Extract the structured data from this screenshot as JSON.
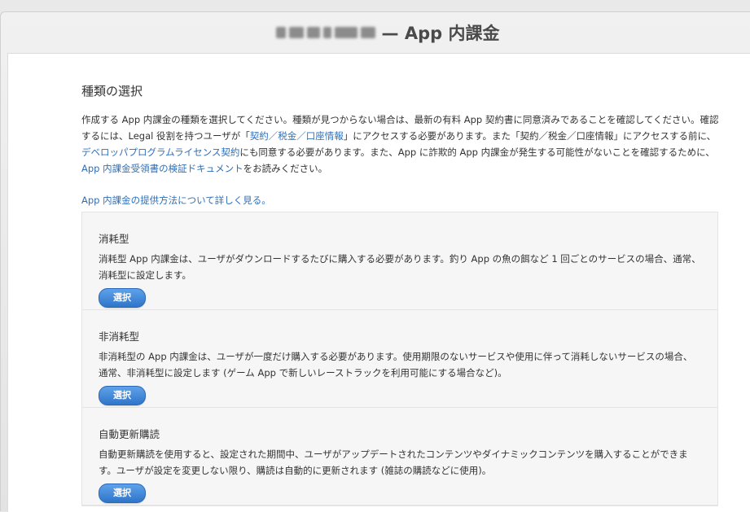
{
  "window": {
    "title_suffix": "— App 内課金"
  },
  "header": {
    "section_title": "種類の選択"
  },
  "description": {
    "part1": "作成する App 内課金の種類を選択してください。種類が見つからない場合は、最新の有料 App 契約書に同意済みであることを確認してください。確認するには、Legal 役割を持つユーザが「",
    "link1": "契約／税金／口座情報",
    "part2": "」にアクセスする必要があります。また「契約／税金／口座情報」にアクセスする前に、",
    "link2": "デベロッパプログラムライセンス契約",
    "part3": "にも同意する必要があります。また、App に詐欺的 App 内課金が発生する可能性がないことを確認するために、",
    "link3": "App 内課金受領書の検証ドキュメント",
    "part4": "をお読みください。"
  },
  "learn_more": "App 内課金の提供方法について詳しく見る。",
  "types": [
    {
      "name": "消耗型",
      "description": "消耗型 App 内課金は、ユーザがダウンロードするたびに購入する必要があります。釣り App の魚の餌など 1 回ごとのサービスの場合、通常、消耗型に設定します。",
      "button_label": "選択"
    },
    {
      "name": "非消耗型",
      "description": "非消耗型の App 内課金は、ユーザが一度だけ購入する必要があります。使用期限のないサービスや使用に伴って消耗しないサービスの場合、通常、非消耗型に設定します (ゲーム App で新しいレーストラックを利用可能にする場合など)。",
      "button_label": "選択"
    },
    {
      "name": "自動更新購読",
      "description": "自動更新購読を使用すると、設定された期間中、ユーザがアップデートされたコンテンツやダイナミックコンテンツを購入することができます。ユーザが設定を変更しない限り、購読は自動的に更新されます (雑誌の購読などに使用)。",
      "button_label": "選択"
    }
  ],
  "colors": {
    "link": "#2f6fb8",
    "button": "#3a80d2",
    "panel_bg": "#f6f6f6"
  }
}
